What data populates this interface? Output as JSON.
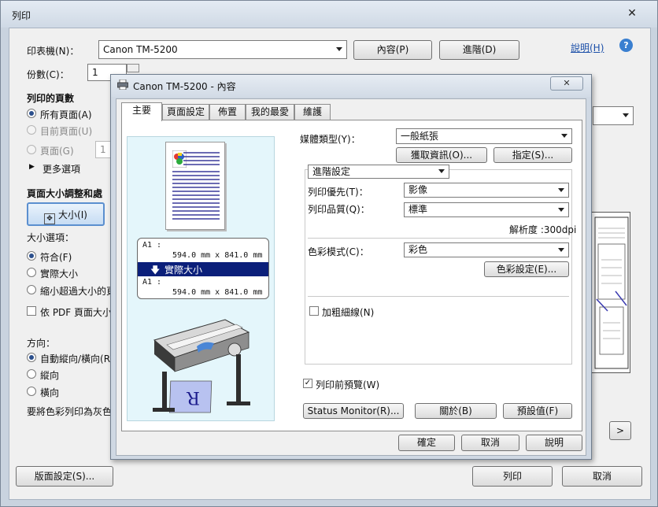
{
  "print_dialog": {
    "title": "列印",
    "close_glyph": "✕",
    "printer_label": "印表機(N)：",
    "printer_value": "Canon TM-5200",
    "properties_button": "內容(P)",
    "advanced_button": "進階(D)",
    "help_link": "說明(H)",
    "help_icon_glyph": "?",
    "copies_label": "份數(C)：",
    "copies_value": "1",
    "range_heading": "列印的頁數",
    "range_all": "所有頁面(A)",
    "range_current": "目前頁面(U)",
    "range_pages": "頁面(G)",
    "range_pages_value": "1",
    "more_options": "更多選項",
    "scale_heading": "頁面大小調整和處",
    "size_button": "大小(I)",
    "size_options_label": "大小選項：",
    "fit": "符合(F)",
    "actual_size": "實際大小",
    "shrink_oversized": "縮小超過大小的頁",
    "pdf_page_size": "依 PDF 頁面大小選",
    "orientation_label": "方向：",
    "orient_auto": "自動縱向/橫向(R)",
    "orient_portrait": "縱向",
    "orient_landscape": "橫向",
    "grayscale_note": "要將色彩列印為灰色",
    "next_page_button": ">",
    "page_setup_button": "版面設定(S)...",
    "print_button": "列印",
    "cancel_button": "取消"
  },
  "properties_dialog": {
    "title": "Canon TM-5200 - 內容",
    "close_glyph": "✕",
    "tabs": [
      "主要",
      "頁面設定",
      "佈置",
      "我的最愛",
      "維護"
    ],
    "left_pane": {
      "size_top_label": "A1 :",
      "size_top_value": "594.0 mm x 841.0 mm",
      "actual_size_label": "實際大小",
      "size_bottom_label": "A1 :",
      "size_bottom_value": "594.0 mm x 841.0 mm",
      "printer_sample_letter": "R"
    },
    "media_type_label": "媒體類型(Y)：",
    "media_type_value": "一般紙張",
    "get_info_button": "獲取資訊(O)...",
    "specify_button": "指定(S)...",
    "advanced_settings_value": "進階設定",
    "print_priority_label": "列印優先(T)：",
    "print_priority_value": "影像",
    "print_quality_label": "列印品質(Q)：",
    "print_quality_value": "標準",
    "resolution_text": "解析度 :300dpi",
    "color_mode_label": "色彩模式(C)：",
    "color_mode_value": "彩色",
    "color_settings_button": "色彩設定(E)...",
    "thicken_lines_label": "加粗細線(N)",
    "preview_before_print_label": "列印前預覽(W)",
    "status_monitor_button": "Status Monitor(R)...",
    "about_button": "關於(B)",
    "defaults_button": "預設值(F)",
    "ok_button": "確定",
    "cancel_button": "取消",
    "help_button": "說明"
  },
  "state": {
    "preview_before_print_checked": true,
    "thicken_lines_checked": false
  },
  "colors": {
    "selection_blue": "#0b1f7a",
    "preview_pane_bg": "#e4f6fb",
    "link_blue": "#1a4ea8"
  }
}
